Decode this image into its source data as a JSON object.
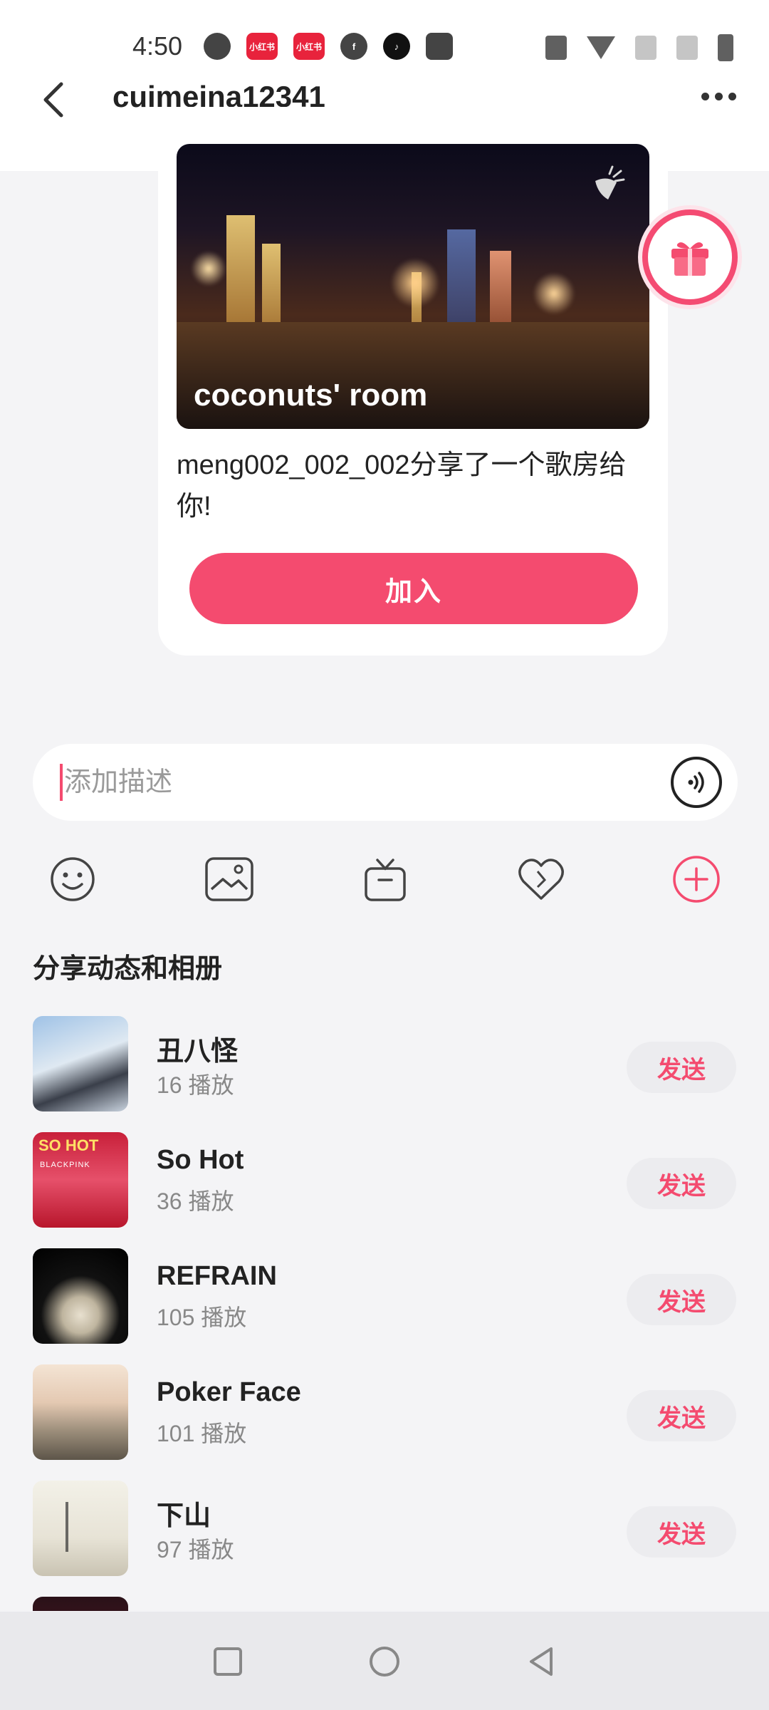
{
  "status_bar": {
    "time": "4:50",
    "left_icons": [
      "app-icon",
      "xiaohongshu-icon",
      "xiaohongshu-icon",
      "facebook-icon",
      "tiktok-icon",
      "inbox-icon"
    ],
    "right_icons": [
      "vibrate-icon",
      "wifi-icon",
      "no-signal-icon",
      "no-signal-icon",
      "battery-charging-icon"
    ],
    "app_badge_1": "小红书",
    "app_badge_2": "小红书"
  },
  "header": {
    "title": "cuimeina12341"
  },
  "room_card": {
    "room_name": "coconuts' room",
    "share_text": "meng002_002_002分享了一个歌房给你!",
    "join_label": "加入"
  },
  "description": {
    "placeholder": "添加描述",
    "value": ""
  },
  "toolbar": {
    "icons": [
      "emoji-icon",
      "image-icon",
      "gift-box-icon",
      "heart-icon",
      "add-icon"
    ]
  },
  "section": {
    "title": "分享动态和相册"
  },
  "songs": [
    {
      "title": "丑八怪",
      "plays": "16 播放",
      "send": "发送"
    },
    {
      "title": "So Hot",
      "plays": "36 播放",
      "send": "发送",
      "cover_text_1": "SO HOT",
      "cover_text_2": "BLACKPINK"
    },
    {
      "title": "REFRAIN",
      "plays": "105 播放",
      "send": "发送"
    },
    {
      "title": "Poker Face",
      "plays": "101 播放",
      "send": "发送"
    },
    {
      "title": "下山",
      "plays": "97 播放",
      "send": "发送"
    }
  ],
  "colors": {
    "accent": "#f44b6f",
    "background": "#f4f4f6"
  }
}
